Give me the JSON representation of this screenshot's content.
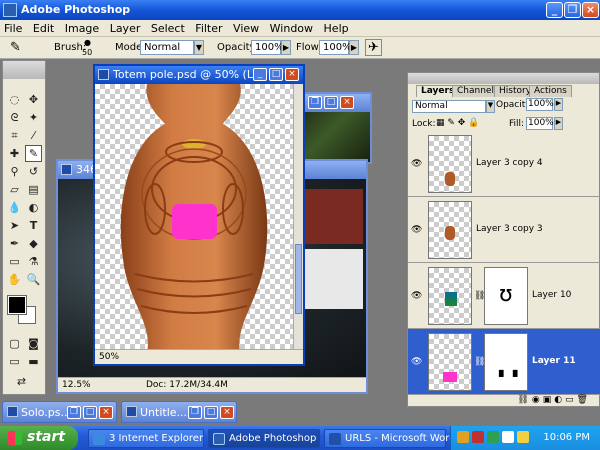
{
  "app": {
    "title": "Adobe Photoshop"
  },
  "menu": [
    "File",
    "Edit",
    "Image",
    "Layer",
    "Select",
    "Filter",
    "View",
    "Window",
    "Help"
  ],
  "options": {
    "brush_label": "Brush:",
    "brush_size": "50",
    "mode_label": "Mode:",
    "mode_value": "Normal",
    "opacity_label": "Opacity:",
    "opacity_value": "100%",
    "flow_label": "Flow:",
    "flow_value": "100%"
  },
  "documents": {
    "active": {
      "title": "Totem pole.psd @ 50% (La...",
      "zoom": "50%"
    },
    "back": {
      "title": "346",
      "zoom": "12.5%",
      "doc_info": "Doc: 17.2M/34.4M"
    }
  },
  "layers_panel": {
    "tabs": [
      "Layers",
      "Channels",
      "History",
      "Actions"
    ],
    "blend_mode": "Normal",
    "opacity_label": "Opacity:",
    "opacity_value": "100%",
    "lock_label": "Lock:",
    "fill_label": "Fill:",
    "fill_value": "100%",
    "layers": [
      {
        "name": "Layer 3 copy 4",
        "selected": false
      },
      {
        "name": "Layer 3 copy 3",
        "selected": false
      },
      {
        "name": "Layer 10",
        "selected": false
      },
      {
        "name": "Layer 11",
        "selected": true
      }
    ]
  },
  "minimized": [
    "Solo.ps...",
    "Untitle..."
  ],
  "taskbar": {
    "start": "start",
    "items": [
      "3 Internet Explorer",
      "Adobe Photoshop",
      "URLS - Microsoft Word"
    ],
    "clock": "10:06 PM"
  },
  "colors": {
    "accent": "#0c45c0",
    "totem_orange": "#c9703a",
    "magenta": "#ff33cc",
    "selected_layer": "#2f5fcf"
  }
}
